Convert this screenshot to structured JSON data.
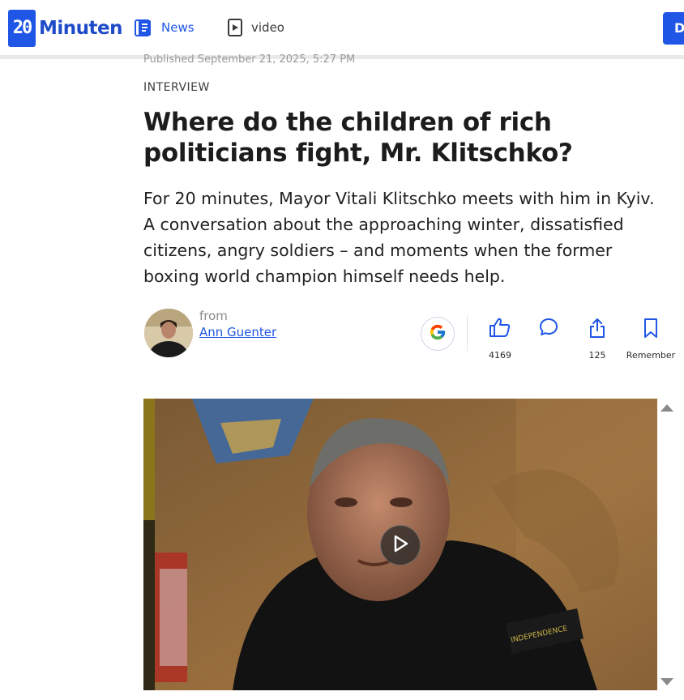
{
  "header": {
    "logo_digits": "20",
    "logo_text": "Minuten",
    "nav": [
      {
        "label": "News",
        "icon": "news-icon",
        "active": true
      },
      {
        "label": "video",
        "icon": "video-icon",
        "active": false
      }
    ],
    "cta_label": "D",
    "brand_color": "#1f56e6"
  },
  "article": {
    "published": "Published September 21, 2025, 5:27 PM",
    "kicker": "INTERVIEW",
    "headline": "Where do the children of rich politicians fight, Mr. Klitschko?",
    "lead": "For 20 minutes, Mayor Vitali Klitschko meets with him in Kyiv. A conversation about the approaching winter, dissatisfied citizens, angry soldiers – and moments when the former boxing world champion himself needs help.",
    "author": {
      "from_label": "from",
      "name": "Ann Guenter"
    }
  },
  "actions": {
    "google_icon": "google-icon",
    "like": {
      "icon": "thumbs-up-icon",
      "count": "4169"
    },
    "comment": {
      "icon": "comment-icon",
      "count": ""
    },
    "share": {
      "icon": "share-icon",
      "count": "125"
    },
    "bookmark": {
      "icon": "bookmark-icon",
      "label": "Remember"
    }
  },
  "video": {
    "play_icon": "play-icon"
  }
}
